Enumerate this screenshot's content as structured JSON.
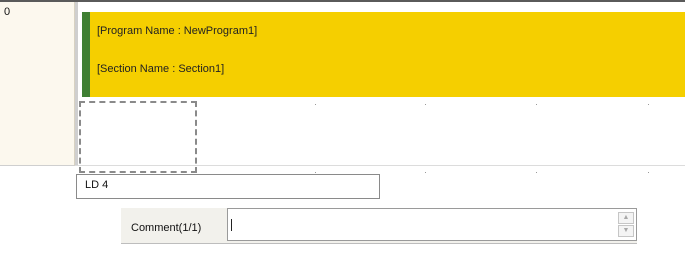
{
  "ladder": {
    "row_number": "0",
    "program_line": "[Program Name : NewProgram1]",
    "section_line": "[Section Name : Section1]",
    "colors": {
      "header_bg": "#f5cf00",
      "header_marker": "#3f7f33",
      "gutter_bg": "#fcf8ee"
    }
  },
  "instruction_input": {
    "value": "LD 4"
  },
  "comment": {
    "label": "Comment(1/1)",
    "value": "",
    "spin_up_icon": "triangle-up-icon",
    "spin_down_icon": "triangle-down-icon"
  }
}
